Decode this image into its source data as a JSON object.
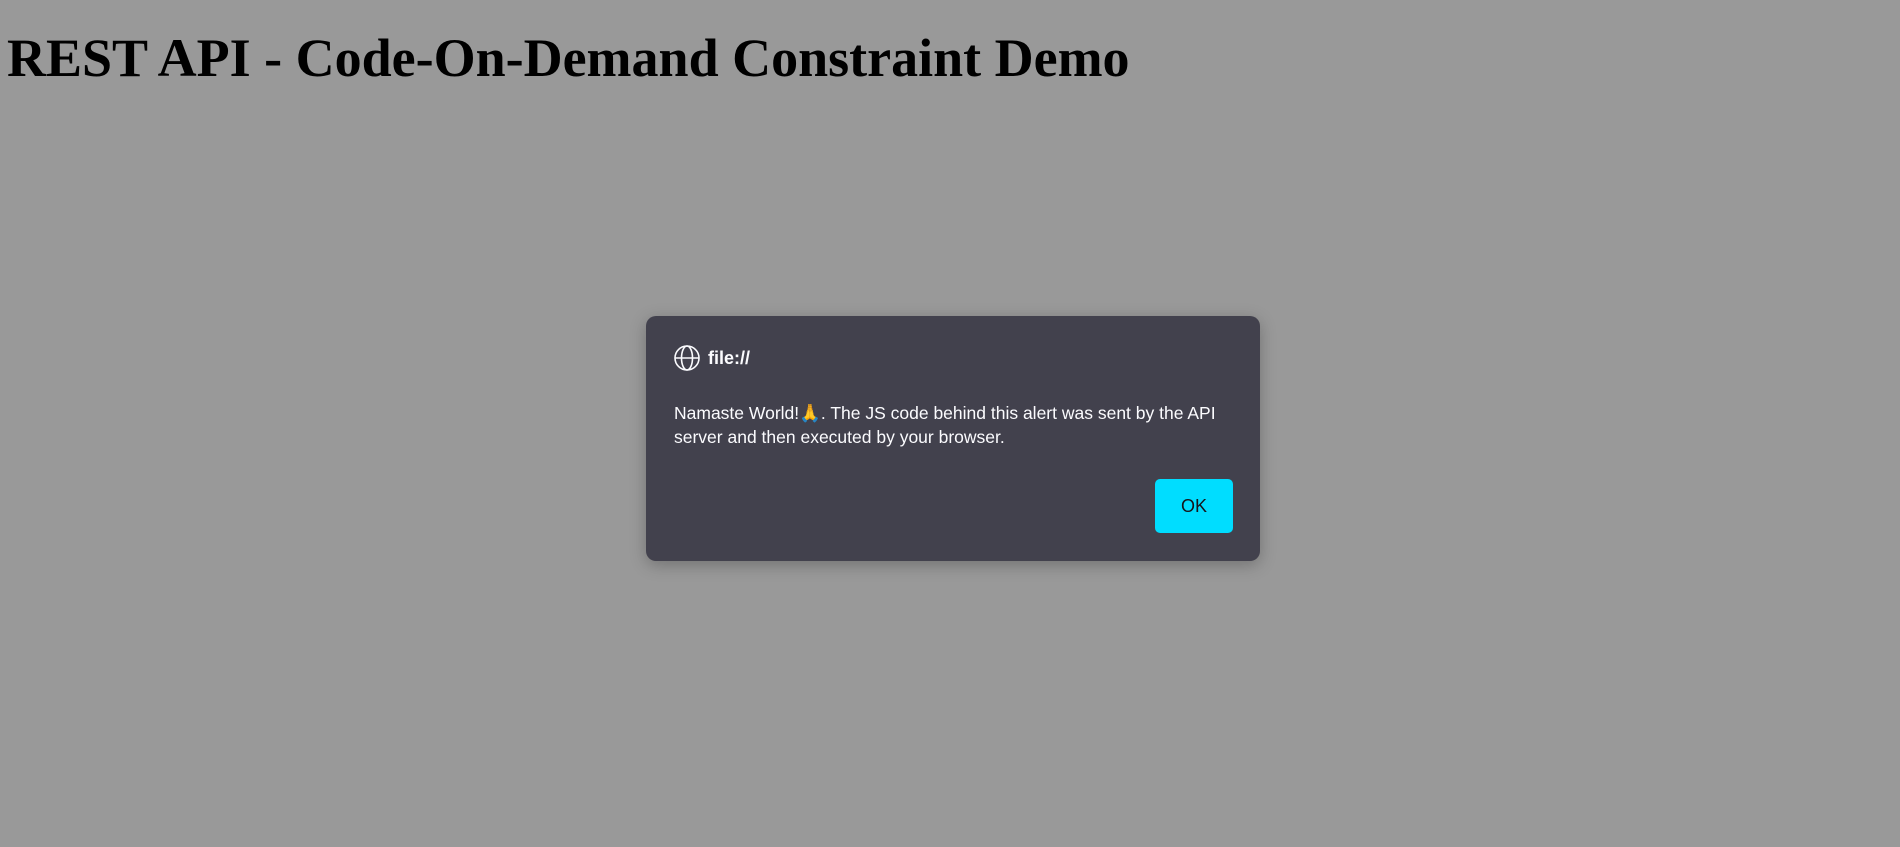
{
  "page": {
    "heading": "REST API - Code-On-Demand Constraint Demo"
  },
  "dialog": {
    "origin": "file://",
    "message": "Namaste World!🙏. The JS code behind this alert was sent by the API server and then executed by your browser.",
    "ok_label": "OK",
    "icon": "globe-icon"
  },
  "colors": {
    "dialog_background": "#42414d",
    "accent_button": "#00ddff",
    "overlay": "rgba(0,0,0,0.4)"
  }
}
